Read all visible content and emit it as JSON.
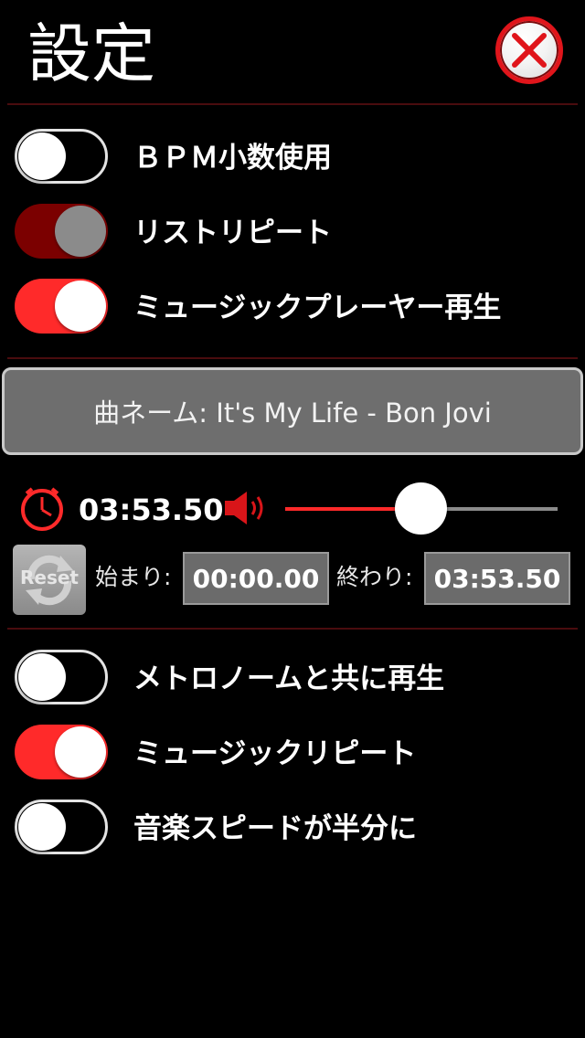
{
  "header": {
    "title": "設定",
    "close_icon": "close-icon"
  },
  "settings_top": [
    {
      "label": "ＢＰＭ小数使用",
      "state": "off"
    },
    {
      "label": "リストリピート",
      "state": "on-disabled"
    },
    {
      "label": "ミュージックプレーヤー再生",
      "state": "on"
    }
  ],
  "song": {
    "label": "曲ネーム: It's My Life - Bon Jovi"
  },
  "playback": {
    "elapsed": "03:53.50",
    "volume_level": 0.5,
    "reset_label": "Reset",
    "start_label": "始まり:",
    "start_value": "00:00.00",
    "end_label": "終わり:",
    "end_value": "03:53.50"
  },
  "settings_bottom": [
    {
      "label": "メトロノームと共に再生",
      "state": "off"
    },
    {
      "label": "ミュージックリピート",
      "state": "on"
    },
    {
      "label": "音楽スピードが半分に",
      "state": "off"
    }
  ],
  "colors": {
    "accent": "#ff2a2a",
    "dark_accent": "#7b0000",
    "background": "#000000"
  }
}
